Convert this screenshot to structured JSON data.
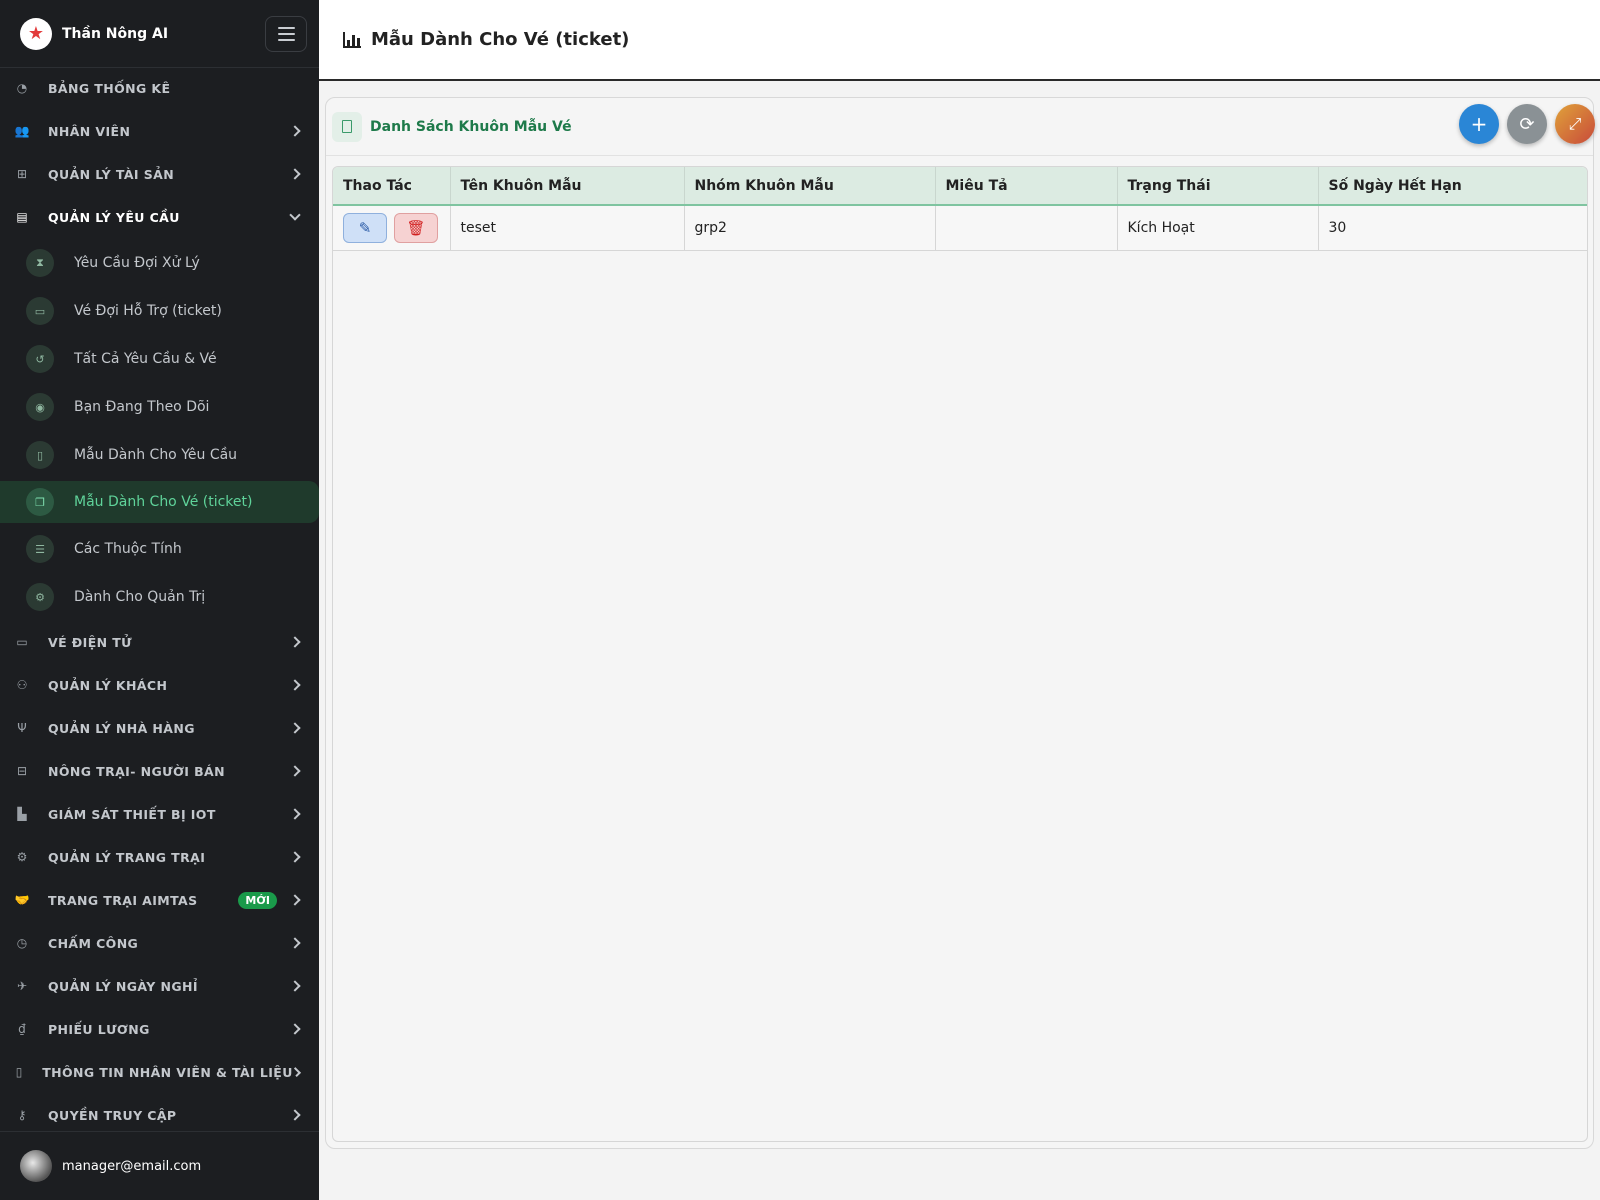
{
  "app": {
    "brand": "Thần Nông AI",
    "page_title": "Mẫu Dành Cho Vé (ticket)"
  },
  "sidebar": {
    "top_items": [
      {
        "label": "BẢNG THỐNG KÊ",
        "icon": "gauge-icon"
      },
      {
        "label": "NHÂN VIÊN",
        "icon": "users-icon"
      },
      {
        "label": "QUẢN LÝ TÀI SẢN",
        "icon": "sitemap-icon"
      },
      {
        "label": "QUẢN LÝ YÊU CẦU",
        "icon": "clipboard-icon"
      }
    ],
    "sub_items": [
      {
        "label": "Yêu Cầu Đợi Xử Lý",
        "icon": "hourglass-icon"
      },
      {
        "label": "Vé Đợi Hỗ Trợ (ticket)",
        "icon": "ticket-icon"
      },
      {
        "label": "Tất Cả Yêu Cầu & Vé",
        "icon": "history-icon"
      },
      {
        "label": "Bạn Đang Theo Dõi",
        "icon": "eye-icon"
      },
      {
        "label": "Mẫu Dành Cho Yêu Cầu",
        "icon": "document-icon"
      },
      {
        "label": "Mẫu Dành Cho Vé (ticket)",
        "icon": "copy-icon"
      },
      {
        "label": "Các Thuộc Tính",
        "icon": "sliders-icon"
      },
      {
        "label": "Dành Cho Quản Trị",
        "icon": "user-gear-icon"
      }
    ],
    "bottom_items": [
      {
        "label": "VÉ ĐIỆN TỬ",
        "icon": "ticket-icon"
      },
      {
        "label": "QUẢN LÝ KHÁCH",
        "icon": "people-icon"
      },
      {
        "label": "QUẢN LÝ NHÀ HÀNG",
        "icon": "utensils-icon"
      },
      {
        "label": "NÔNG TRẠI- NGƯỜI BÁN",
        "icon": "store-icon"
      },
      {
        "label": "GIÁM SÁT THIẾT BỊ IOT",
        "icon": "factory-icon"
      },
      {
        "label": "QUẢN LÝ TRANG TRẠI",
        "icon": "tractor-icon"
      },
      {
        "label": "TRANG TRẠI AIMTAS",
        "icon": "handshake-icon",
        "badge": "MỚI"
      },
      {
        "label": "CHẤM CÔNG",
        "icon": "clock-icon"
      },
      {
        "label": "QUẢN LÝ NGÀY NGHỈ",
        "icon": "plane-icon"
      },
      {
        "label": "PHIẾU LƯƠNG",
        "icon": "payslip-icon"
      },
      {
        "label": "THÔNG TIN NHÂN VIÊN & TÀI LIỆU",
        "icon": "book-icon"
      },
      {
        "label": "QUYỀN TRUY CẬP",
        "icon": "key-icon"
      }
    ],
    "user_email": "manager@email.com"
  },
  "card": {
    "title": "Danh Sách Khuôn Mẫu Vé",
    "columns": [
      "Thao Tác",
      "Tên Khuôn Mẫu",
      "Nhóm Khuôn Mẫu",
      "Miêu Tả",
      "Trạng Thái",
      "Số Ngày Hết Hạn"
    ],
    "rows": [
      {
        "name": "teset",
        "group": "grp2",
        "description": "",
        "status": "Kích Hoạt",
        "expiry_days": "30"
      }
    ]
  },
  "colors": {
    "sidebar_bg": "#1c1e21",
    "accent_green": "#1e7a4a",
    "active_text": "#5fd39a",
    "add_blue": "#2a86d6"
  }
}
